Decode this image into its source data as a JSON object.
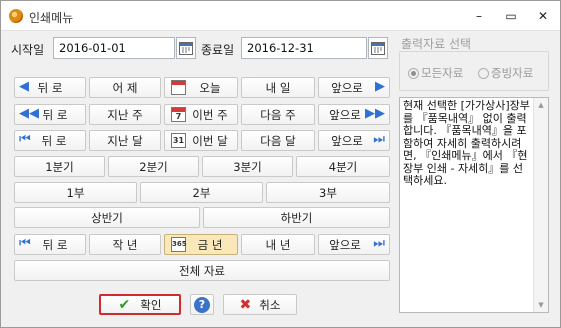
{
  "window": {
    "title": "인쇄메뉴",
    "controls": {
      "minimize": "–",
      "restore": "▭",
      "close": "✕"
    }
  },
  "date_range": {
    "start_label": "시작일",
    "start_value": "2016-01-01",
    "end_label": "종료일",
    "end_value": "2016-12-31"
  },
  "day_row": {
    "back": "뒤 로",
    "prev": "어  제",
    "current": "오늘",
    "next": "내 일",
    "forward": "앞으로"
  },
  "week_row": {
    "back": "뒤 로",
    "prev": "지난 주",
    "current": "이번 주",
    "current_num": "7",
    "next": "다음 주",
    "forward": "앞으로"
  },
  "month_row": {
    "back": "뒤 로",
    "prev": "지난 달",
    "current": "이번 달",
    "current_num": "31",
    "next": "다음 달",
    "forward": "앞으로"
  },
  "quarters": [
    "1분기",
    "2분기",
    "3분기",
    "4분기"
  ],
  "parts": [
    "1부",
    "2부",
    "3부"
  ],
  "halves": [
    "상반기",
    "하반기"
  ],
  "year_row": {
    "back": "뒤 로",
    "prev": "작 년",
    "current": "금 년",
    "current_num": "365",
    "next": "내 년",
    "forward": "앞으로"
  },
  "all_data": "전체 자료",
  "actions": {
    "ok": "확인",
    "help": "?",
    "cancel": "취소"
  },
  "output_group": {
    "title": "출력자료 선택",
    "options": [
      "모든자료",
      "증빙자료"
    ],
    "selected": "모든자료"
  },
  "info_text": "현재 선택한 [가가상사]장부를 『품목내역』 없이 출력합니다. 『품목내역』을 포함하여 자세히 출력하시려면, 『인쇄메뉴』에서 『현장부 인쇄 - 자세히』를 선택하세요."
}
